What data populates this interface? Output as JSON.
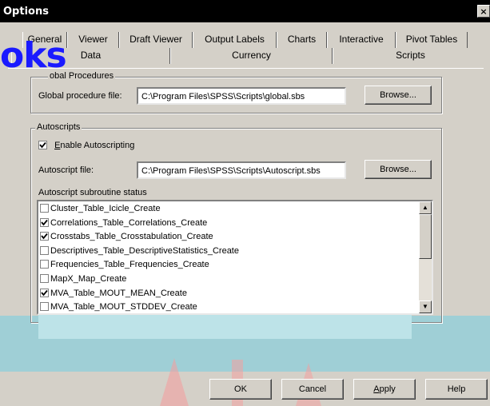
{
  "window": {
    "title": "Options",
    "close_glyph": "×"
  },
  "tabs_row1": [
    "General",
    "Viewer",
    "Draft Viewer",
    "Output Labels",
    "Charts",
    "Interactive",
    "Pivot Tables"
  ],
  "tabs_row2": [
    "Data",
    "Currency",
    "Scripts"
  ],
  "active_tab": "Scripts",
  "overlay_text": "oks",
  "global": {
    "legend": "obal Procedures",
    "file_label": "Global procedure file:",
    "file_value": "C:\\Program Files\\SPSS\\Scripts\\global.sbs",
    "browse": "Browse..."
  },
  "autoscripts": {
    "legend": "Autoscripts",
    "enable_label": "Enable Autoscripting",
    "enable_checked": true,
    "file_label": "Autoscript file:",
    "file_value": "C:\\Program Files\\SPSS\\Scripts\\Autoscript.sbs",
    "browse": "Browse...",
    "status_label": "Autoscript subroutine status",
    "items": [
      {
        "label": "Cluster_Table_Icicle_Create",
        "checked": false
      },
      {
        "label": "Correlations_Table_Correlations_Create",
        "checked": true
      },
      {
        "label": "Crosstabs_Table_Crosstabulation_Create",
        "checked": true
      },
      {
        "label": "Descriptives_Table_DescriptiveStatistics_Create",
        "checked": false
      },
      {
        "label": "Frequencies_Table_Frequencies_Create",
        "checked": false
      },
      {
        "label": "MapX_Map_Create",
        "checked": false
      },
      {
        "label": "MVA_Table_MOUT_MEAN_Create",
        "checked": true
      },
      {
        "label": "MVA_Table_MOUT_STDDEV_Create",
        "checked": false
      }
    ]
  },
  "buttons": {
    "ok": "OK",
    "cancel": "Cancel",
    "apply": "Apply",
    "help": "Help"
  },
  "colors": {
    "background_band": "#9fcfd6",
    "overlay_text": "#1a1aff",
    "watermark_red": "#e03030"
  }
}
